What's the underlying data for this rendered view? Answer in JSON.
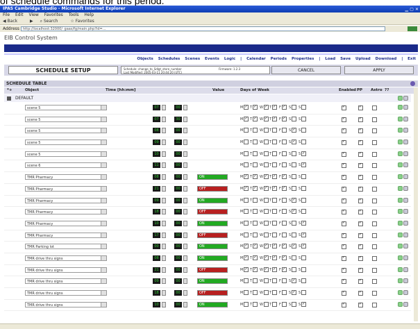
{
  "caption": "of schedule commands for this period.",
  "browser": {
    "title": "IPAS Cambridge Studio - Microsoft Internet Explorer",
    "menu": [
      "File",
      "Edit",
      "View",
      "Favorites",
      "Tools",
      "Help"
    ],
    "toolbar": [
      "Back",
      "Search",
      "Favorites"
    ],
    "address_label": "Address",
    "address": "http://localhost:32000/_gaas/fg/main.php?id=..."
  },
  "app": {
    "title": "EIB Control System",
    "nav": [
      "Objects",
      "Schedules",
      "Scenes",
      "Events",
      "Logic",
      "|",
      "Calendar",
      "Periods",
      "Properties",
      "|",
      "Load",
      "Save",
      "Upload",
      "Download",
      "|",
      "Exit"
    ]
  },
  "setup": {
    "title": "SCHEDULE SETUP",
    "info_line1": "Schedule: change_to_Sdlgt_store_number",
    "info_line2": "Last Modified: 2005-03-11 20:44:20 (UTC)",
    "firmware": "Firmware: 1.2.3",
    "cancel": "CANCEL",
    "apply": "APPLY"
  },
  "table": {
    "header": "SCHEDULE TABLE",
    "columns": {
      "num": "*+",
      "object": "Object",
      "time": "Time [hh:mm]",
      "value": "Value",
      "days": "Days of Week",
      "enabled": "Enabled",
      "pp": "PP",
      "astro": "Astro",
      "q": "??"
    },
    "default_label": "DEFAULT",
    "day_letters": [
      "M",
      "T",
      "W",
      "T",
      "F",
      "S",
      "S"
    ],
    "rows": [
      {
        "object": "scene 5",
        "hh": "07",
        "mm": "00",
        "value": "",
        "days": [
          1,
          1,
          1,
          1,
          1,
          0,
          0
        ],
        "enabled": 1,
        "pp": 1,
        "astro": 0
      },
      {
        "object": "scene 5",
        "hh": "07",
        "mm": "30",
        "value": "",
        "days": [
          1,
          1,
          1,
          1,
          1,
          0,
          0
        ],
        "enabled": 1,
        "pp": 1,
        "astro": 0
      },
      {
        "object": "scene 5",
        "hh": "08",
        "mm": "00",
        "value": "",
        "days": [
          0,
          0,
          0,
          0,
          0,
          1,
          0
        ],
        "enabled": 1,
        "pp": 1,
        "astro": 0
      },
      {
        "object": "scene 5",
        "hh": "09",
        "mm": "00",
        "value": "",
        "days": [
          0,
          0,
          0,
          0,
          0,
          1,
          0
        ],
        "enabled": 1,
        "pp": 1,
        "astro": 0
      },
      {
        "object": "scene 5",
        "hh": "10",
        "mm": "00",
        "value": "",
        "days": [
          0,
          0,
          0,
          0,
          0,
          0,
          1
        ],
        "enabled": 1,
        "pp": 1,
        "astro": 0
      },
      {
        "object": "scene 6",
        "hh": "11",
        "mm": "00",
        "value": "",
        "days": [
          0,
          0,
          0,
          0,
          0,
          0,
          1
        ],
        "enabled": 1,
        "pp": 1,
        "astro": 0
      },
      {
        "object": "TMR Pharmacy",
        "hh": "08",
        "mm": "00",
        "value": "ON",
        "state": "on",
        "days": [
          1,
          1,
          1,
          1,
          1,
          0,
          0
        ],
        "enabled": 1,
        "pp": 1,
        "astro": 0
      },
      {
        "object": "TMR Pharmacy",
        "hh": "21",
        "mm": "00",
        "value": "OFF",
        "state": "off",
        "days": [
          1,
          1,
          1,
          1,
          1,
          0,
          0
        ],
        "enabled": 1,
        "pp": 1,
        "astro": 0
      },
      {
        "object": "TMR Pharmacy",
        "hh": "09",
        "mm": "00",
        "value": "ON",
        "state": "on",
        "days": [
          0,
          0,
          0,
          0,
          0,
          1,
          0
        ],
        "enabled": 1,
        "pp": 1,
        "astro": 0
      },
      {
        "object": "TMR Pharmacy",
        "hh": "18",
        "mm": "00",
        "value": "OFF",
        "state": "off",
        "days": [
          0,
          0,
          0,
          0,
          0,
          1,
          0
        ],
        "enabled": 1,
        "pp": 1,
        "astro": 0
      },
      {
        "object": "TMR Pharmacy",
        "hh": "10",
        "mm": "00",
        "value": "ON",
        "state": "on",
        "days": [
          0,
          0,
          0,
          0,
          0,
          0,
          1
        ],
        "enabled": 1,
        "pp": 1,
        "astro": 0
      },
      {
        "object": "TMR Pharmacy",
        "hh": "17",
        "mm": "00",
        "value": "OFF",
        "state": "off",
        "days": [
          0,
          0,
          0,
          0,
          0,
          0,
          1
        ],
        "enabled": 1,
        "pp": 1,
        "astro": 0
      },
      {
        "object": "TMR Parking lot",
        "hh": "00",
        "mm": "00",
        "value": "ON",
        "state": "on",
        "days": [
          1,
          1,
          1,
          1,
          1,
          1,
          1
        ],
        "enabled": 1,
        "pp": 1,
        "astro": 0
      },
      {
        "object": "TMR drive thru signs",
        "hh": "08",
        "mm": "00",
        "value": "ON",
        "state": "on",
        "days": [
          1,
          1,
          1,
          1,
          1,
          0,
          0
        ],
        "enabled": 1,
        "pp": 1,
        "astro": 0
      },
      {
        "object": "TMR drive thru signs",
        "hh": "21",
        "mm": "00",
        "value": "OFF",
        "state": "off",
        "days": [
          1,
          1,
          1,
          1,
          1,
          0,
          0
        ],
        "enabled": 1,
        "pp": 1,
        "astro": 0
      },
      {
        "object": "TMR drive thru signs",
        "hh": "09",
        "mm": "00",
        "value": "ON",
        "state": "on",
        "days": [
          0,
          0,
          0,
          0,
          0,
          1,
          0
        ],
        "enabled": 1,
        "pp": 1,
        "astro": 0
      },
      {
        "object": "TMR drive thru signs",
        "hh": "18",
        "mm": "00",
        "value": "OFF",
        "state": "off",
        "days": [
          0,
          0,
          0,
          0,
          0,
          1,
          0
        ],
        "enabled": 1,
        "pp": 1,
        "astro": 0
      },
      {
        "object": "TMR drive thru signs",
        "hh": "10",
        "mm": "00",
        "value": "ON",
        "state": "on",
        "days": [
          0,
          0,
          0,
          0,
          0,
          0,
          1
        ],
        "enabled": 1,
        "pp": 1,
        "astro": 0
      }
    ]
  }
}
